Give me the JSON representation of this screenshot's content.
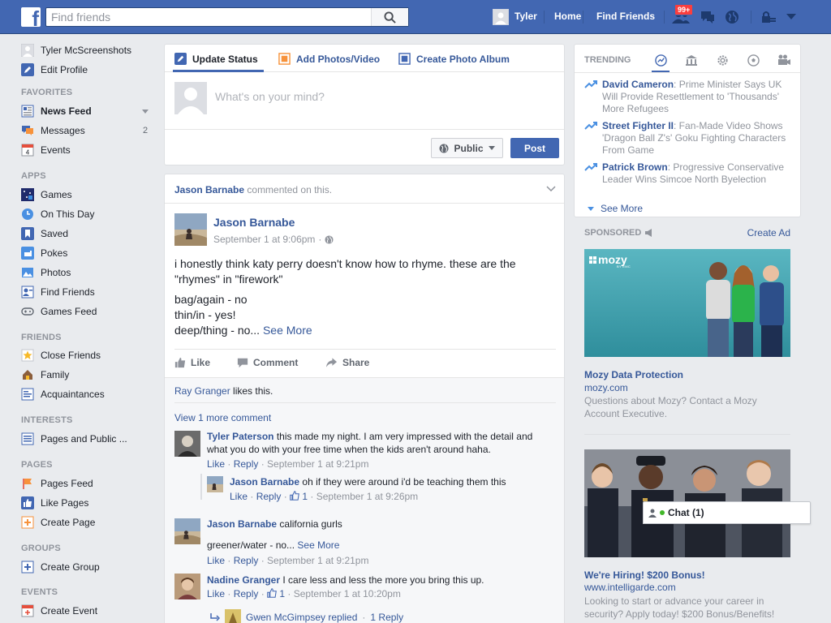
{
  "topbar": {
    "logo": "f",
    "search_placeholder": "Find friends",
    "user_name": "Tyler",
    "home_label": "Home",
    "find_friends_label": "Find Friends",
    "friend_requests_badge": "99+"
  },
  "sidebar": {
    "profile_name": "Tyler McScreenshots",
    "edit_profile": "Edit Profile",
    "sections": {
      "favorites": "FAVORITES",
      "apps": "APPS",
      "friends": "FRIENDS",
      "interests": "INTERESTS",
      "pages": "PAGES",
      "groups": "GROUPS",
      "events": "EVENTS"
    },
    "favorites": [
      "News Feed",
      "Messages",
      "Events"
    ],
    "messages_count": "2",
    "events_day": "4",
    "apps": [
      "Games",
      "On This Day",
      "Saved",
      "Pokes",
      "Photos",
      "Find Friends",
      "Games Feed"
    ],
    "friends": [
      "Close Friends",
      "Family",
      "Acquaintances"
    ],
    "interests": [
      "Pages and Public ..."
    ],
    "pages": [
      "Pages Feed",
      "Like Pages",
      "Create Page"
    ],
    "groups": [
      "Create Group"
    ],
    "events": [
      "Create Event"
    ]
  },
  "composer": {
    "tab_status": "Update Status",
    "tab_photo": "Add Photos/Video",
    "tab_album": "Create Photo Album",
    "placeholder": "What's on your mind?",
    "audience": "Public",
    "post": "Post"
  },
  "story": {
    "header_actor": "Jason Barnabe",
    "header_action": "commented on this.",
    "author": "Jason Barnabe",
    "time": "September 1 at 9:06pm",
    "text_line1": "i honestly think katy perry doesn't know how to rhyme. these are the",
    "text_line2": "\"rhymes\" in \"firework\"",
    "text_line3": "bag/again - no",
    "text_line4": "thin/in - yes!",
    "text_line5": "deep/thing - no...",
    "see_more": "See More",
    "like": "Like",
    "comment": "Comment",
    "share": "Share",
    "likes_name": "Ray Granger",
    "likes_suffix": "likes this.",
    "view_more": "View 1 more comment",
    "comments": [
      {
        "name": "Tyler Paterson",
        "text_a": "this made my night. I am very impressed with the detail and",
        "text_b": "what you do with your free time when the kids aren't around haha.",
        "like": "Like",
        "reply": "Reply",
        "time": "September 1 at 9:21pm"
      },
      {
        "name": "Jason Barnabe",
        "text": "oh if they were around i'd be teaching them this",
        "like": "Like",
        "reply": "Reply",
        "likes": "1",
        "time": "September 1 at 9:26pm"
      },
      {
        "name": "Jason Barnabe",
        "text": "california gurls",
        "text2": "greener/water - no...",
        "see_more": "See More",
        "like": "Like",
        "reply": "Reply",
        "time": "September 1 at 9:21pm"
      },
      {
        "name": "Nadine Granger",
        "text": "I care less and less the more you bring this up.",
        "like": "Like",
        "reply": "Reply",
        "likes": "1",
        "time": "September 1 at 10:20pm"
      }
    ],
    "replied_name": "Gwen McGimpsey replied",
    "replied_count": "1 Reply"
  },
  "trending": {
    "title": "TRENDING",
    "items": [
      {
        "name": "David Cameron",
        "text": ": Prime Minister Says UK Will Provide Resettlement to 'Thousands' More Refugees"
      },
      {
        "name": "Street Fighter II",
        "text": ": Fan-Made Video Shows 'Dragon Ball Z's' Goku Fighting Characters From Game"
      },
      {
        "name": "Patrick Brown",
        "text": ": Progressive Conservative Leader Wins Simcoe North Byelection"
      }
    ],
    "see_more": "See More"
  },
  "sponsored": {
    "label": "SPONSORED",
    "create_ad": "Create Ad",
    "ads": [
      {
        "brand": "mozy",
        "brand_sub": "BY EMC",
        "title": "Mozy Data Protection",
        "url": "mozy.com",
        "desc": "Questions about Mozy? Contact a Mozy Account Executive."
      },
      {
        "title": "We're Hiring! $200 Bonus!",
        "url": "www.intelligarde.com",
        "desc": "Looking to start or advance your career in security? Apply today! $200 Bonus/Benefits!"
      }
    ]
  },
  "chat": {
    "label": "Chat (1)"
  },
  "colors": {
    "brand": "#4267b2",
    "link": "#365899",
    "badge": "#fa3e3e",
    "online": "#42b72a"
  }
}
